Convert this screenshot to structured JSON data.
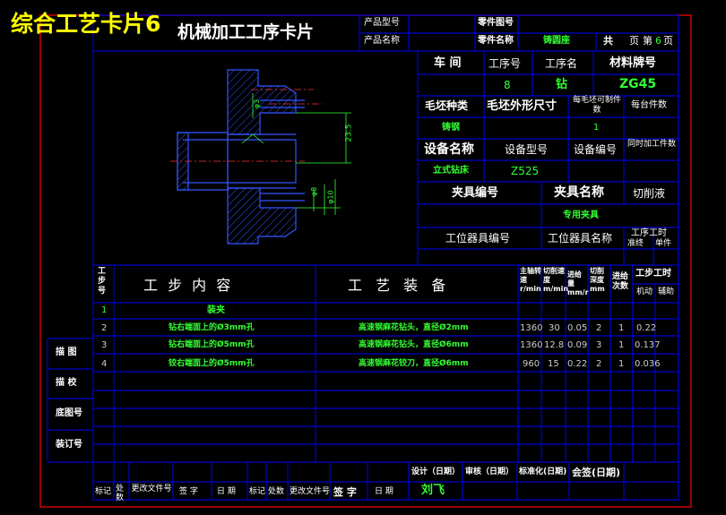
{
  "overlay_title": "综合工艺卡片6",
  "card_title": "机械加工工序卡片",
  "header": {
    "product_model_label": "产品型号",
    "product_name_label": "产品名称",
    "part_no_label": "零件图号",
    "part_name_label": "零件名称",
    "part_name_value": "铸圆座",
    "total_label": "共",
    "page_label": "页",
    "page_no_label": "第",
    "page_no_value": "6",
    "page_suffix": "页"
  },
  "info": {
    "workshop_label": "车 间",
    "op_no_label": "工序号",
    "op_name_label": "工序名",
    "material_label": "材料牌号",
    "op_no_value": "8",
    "op_name_value": "钻",
    "material_value": "ZG45",
    "blank_type_label": "毛坯种类",
    "blank_size_label": "毛坯外形尺寸",
    "parts_per_blank_label": "每毛坯可制件数",
    "parts_per_unit_label": "每台件数",
    "blank_type_value": "铸钢",
    "parts_per_blank_value": "1",
    "equip_name_label": "设备名称",
    "equip_model_label": "设备型号",
    "equip_no_label": "设备编号",
    "simul_parts_label": "同时加工件数",
    "equip_name_value": "立式钻床",
    "equip_model_value": "Z525",
    "fixture_no_label": "夹具编号",
    "fixture_name_label": "夹具名称",
    "coolant_label": "切削液",
    "fixture_name_value": "专用夹具",
    "station_tool_no_label": "工位器具编号",
    "station_tool_name_label": "工位器具名称",
    "op_time_label": "工序工时",
    "prep_label": "准终",
    "unit_label": "单件"
  },
  "drawing": {
    "dim_1": "23.5",
    "dim_2": "φ8",
    "dim_3": "φ10",
    "dim_4": "φ3"
  },
  "table": {
    "step_no_label": "工步号",
    "step_content_label": "工 步 内 容",
    "equipment_label": "工 艺 装 备",
    "spindle_speed_label": "主轴转速 r/min",
    "cutting_speed_label": "切削速度 m/min",
    "feed_label": "进给量 mm/r",
    "depth_label": "切削深度 mm",
    "passes_label": "进给次数",
    "step_time_label": "工步工时",
    "machine_time_label": "机动",
    "aux_time_label": "辅助",
    "rows": [
      {
        "no": "1",
        "content": "装夹",
        "equip": "",
        "speed": "",
        "vc": "",
        "feed": "",
        "depth": "",
        "passes": "",
        "time": ""
      },
      {
        "no": "2",
        "content": "钻右端面上的Ø3mm孔",
        "equip": "高速钢麻花钻头，直径Ø2mm",
        "speed": "1360",
        "vc": "30",
        "feed": "0.05",
        "depth": "2",
        "passes": "1",
        "time": "0.22"
      },
      {
        "no": "3",
        "content": "钻右端面上的Ø5mm孔",
        "equip": "高速钢麻花钻头，直径Ø6mm",
        "speed": "1360",
        "vc": "12.8",
        "feed": "0.09",
        "depth": "3",
        "passes": "1",
        "time": "0.137"
      },
      {
        "no": "4",
        "content": "铰右端面上的Ø5mm孔",
        "equip": "高速钢麻花铰刀，直径Ø6mm",
        "speed": "960",
        "vc": "15",
        "feed": "0.22",
        "depth": "2",
        "passes": "1",
        "time": "0.036"
      }
    ]
  },
  "side": {
    "trace_label": "描 图",
    "check_label": "描 校",
    "base_no_label": "底图号",
    "binding_no_label": "装订号"
  },
  "footer": {
    "design_label": "设计（日期）",
    "review_label": "审核（日期）",
    "standard_label": "标准化(日期)",
    "sign_label": "会签(日期)",
    "designer_value": "刘飞",
    "mark_label": "标记",
    "count_label": "处数",
    "change_doc_label": "更改文件号",
    "sign_col_label": "签 字",
    "date_col_label": "日 期",
    "mark2_label": "标记",
    "count2_label": "处数",
    "change_doc2_label": "更改文件号",
    "sign2_label": "签 字",
    "date2_label": "日 期"
  },
  "colors": {
    "background": "#000000",
    "frame": "#ff0000",
    "grid": "#0000ff",
    "value_text": "#33ff33",
    "title_overlay": "#ffff00"
  }
}
